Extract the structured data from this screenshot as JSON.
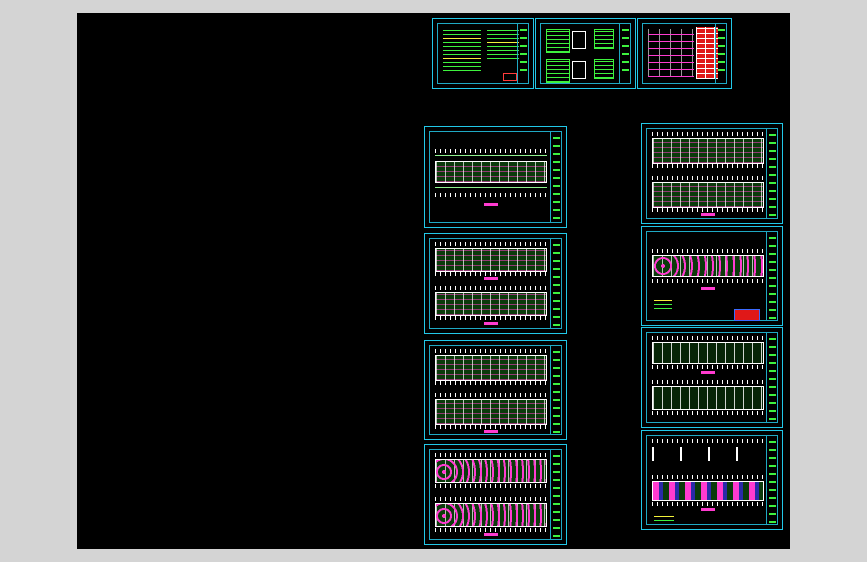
{
  "viewer": {
    "background_color": "#d4d4d4",
    "canvas_color": "#000000",
    "frame_color": "#22c8e8"
  },
  "sheets": [
    {
      "name": "sheet-design-notes",
      "kind": "notes"
    },
    {
      "name": "sheet-system-diagram",
      "kind": "diagram"
    },
    {
      "name": "sheet-equipment-table",
      "kind": "table"
    },
    {
      "name": "sheet-floor-plan-1",
      "kind": "plan-single"
    },
    {
      "name": "sheet-floor-plan-2",
      "kind": "plan-double"
    },
    {
      "name": "sheet-floor-plan-3",
      "kind": "plan-double"
    },
    {
      "name": "sheet-floor-plan-4",
      "kind": "plan-double"
    },
    {
      "name": "sheet-floor-plan-5",
      "kind": "plan-double"
    },
    {
      "name": "sheet-floor-plan-6",
      "kind": "plan-single"
    },
    {
      "name": "sheet-floor-plan-7",
      "kind": "plan-double"
    },
    {
      "name": "sheet-floor-plan-8",
      "kind": "plan-elevation"
    }
  ]
}
